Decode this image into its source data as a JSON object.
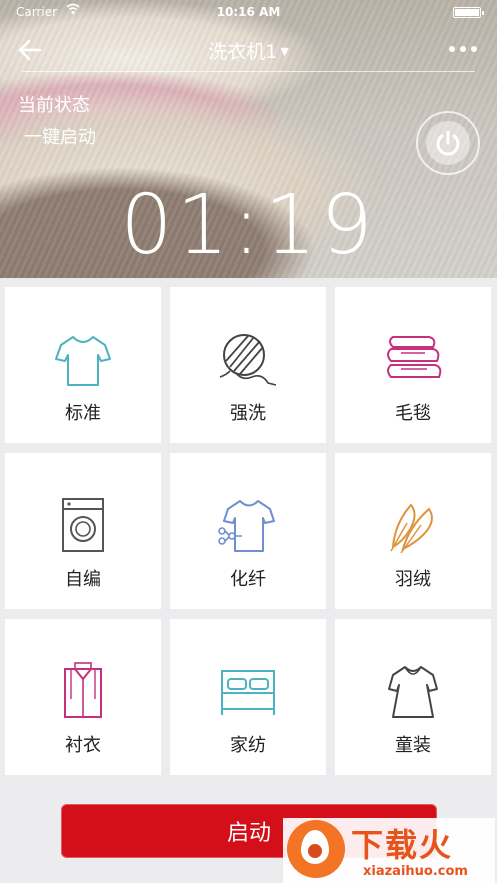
{
  "status_bar": {
    "carrier": "Carrier",
    "time": "10:16 AM"
  },
  "nav": {
    "title": "洗衣机1"
  },
  "hero": {
    "status_label": "当前状态",
    "mode": "一键启动",
    "timer": "01:19"
  },
  "programs": [
    {
      "label": "标准",
      "icon": "tshirt-icon"
    },
    {
      "label": "强洗",
      "icon": "yarn-ball-icon"
    },
    {
      "label": "毛毯",
      "icon": "folded-blanket-icon"
    },
    {
      "label": "自编",
      "icon": "washing-machine-icon"
    },
    {
      "label": "化纤",
      "icon": "synthetic-shirt-icon"
    },
    {
      "label": "羽绒",
      "icon": "feather-icon"
    },
    {
      "label": "衬衣",
      "icon": "dress-shirt-icon"
    },
    {
      "label": "家纺",
      "icon": "bed-icon"
    },
    {
      "label": "童装",
      "icon": "kids-dress-icon"
    }
  ],
  "start_button": {
    "label": "启动"
  },
  "colors": {
    "accent": "#d3101a",
    "teal": "#4fb1c4",
    "magenta": "#c7307f",
    "gray": "#555555",
    "blue": "#6f8fd0",
    "orange": "#e0933a"
  },
  "watermark": {
    "text": "下载火",
    "url": "xiazaihuo.com"
  }
}
